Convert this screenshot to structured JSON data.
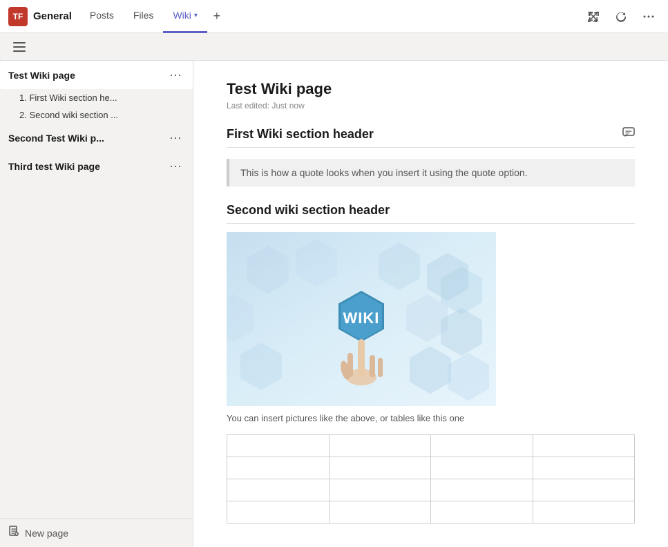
{
  "topbar": {
    "avatar_initials": "TF",
    "team_name": "General",
    "tabs": [
      {
        "label": "Posts",
        "active": false
      },
      {
        "label": "Files",
        "active": false
      },
      {
        "label": "Wiki",
        "active": true,
        "has_arrow": true
      }
    ],
    "add_tab_label": "+",
    "action_icons": [
      "expand-icon",
      "refresh-icon",
      "more-icon"
    ]
  },
  "sub_topbar": {
    "hamburger_label": "☰"
  },
  "sidebar": {
    "pages": [
      {
        "title": "Test Wiki page",
        "selected": true,
        "has_more": true,
        "sections": [
          {
            "index": "1.",
            "label": "First Wiki section he..."
          },
          {
            "index": "2.",
            "label": "Second wiki section ..."
          }
        ]
      },
      {
        "title": "Second Test Wiki p...",
        "selected": false,
        "has_more": true,
        "sections": []
      },
      {
        "title": "Third test Wiki page",
        "selected": false,
        "has_more": true,
        "sections": []
      }
    ],
    "new_page_label": "New page"
  },
  "wiki": {
    "page_title": "Test Wiki page",
    "last_edited": "Last edited: Just now",
    "section1_header": "First Wiki section header",
    "quote_text": "This is how a quote looks when you insert it using the quote option.",
    "section2_header": "Second wiki section header",
    "image_caption": "You can insert pictures like the above, or tables like this one",
    "table_rows": 4,
    "table_cols": 4
  }
}
